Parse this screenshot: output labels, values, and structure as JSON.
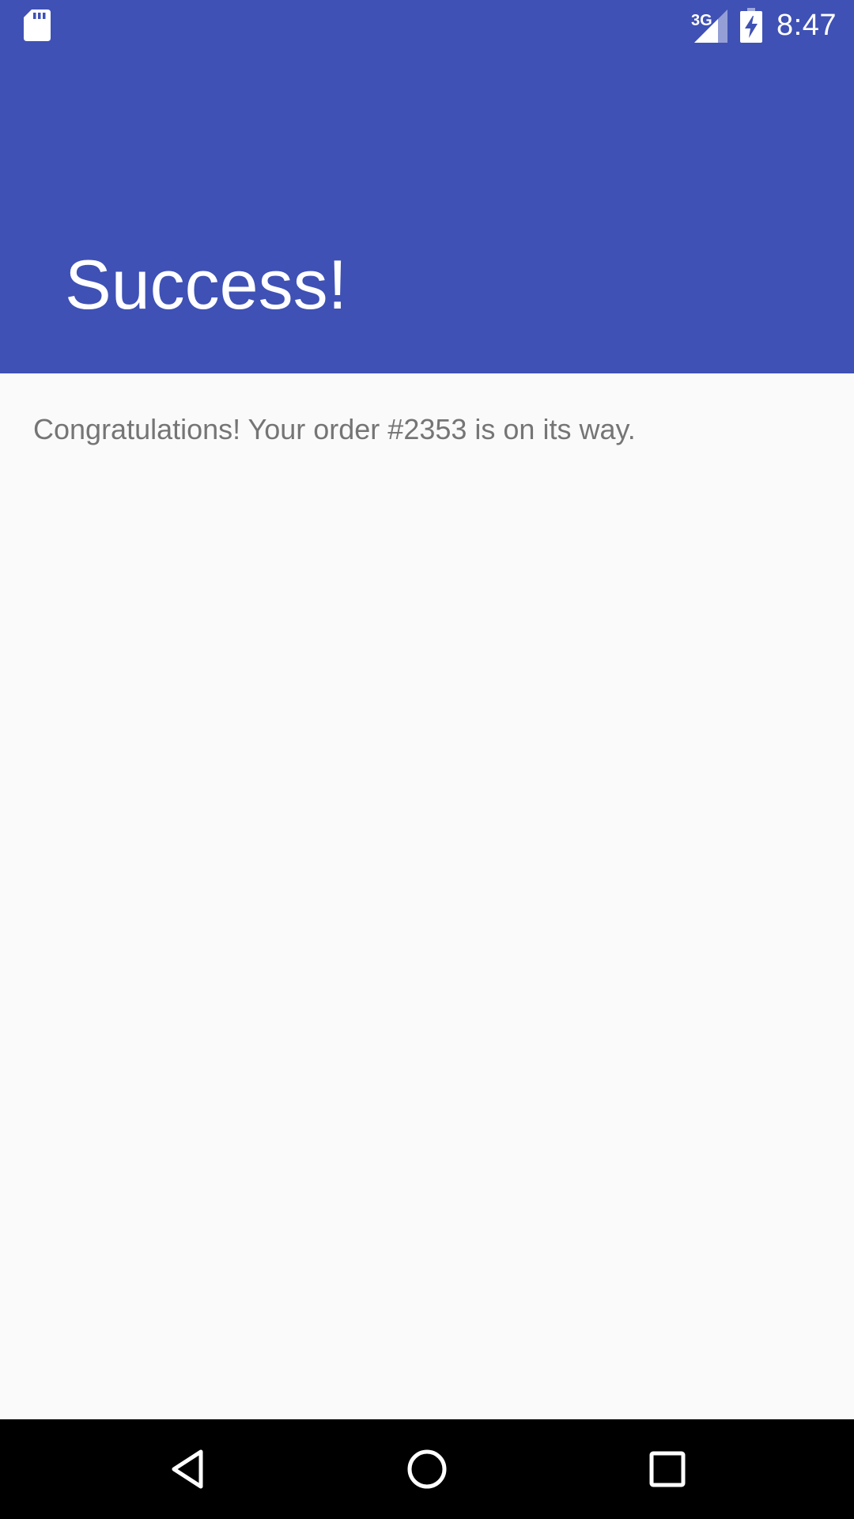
{
  "status_bar": {
    "network_type": "3G",
    "time": "8:47",
    "icons": [
      "sd-card-icon",
      "signal-icon",
      "battery-charging-icon"
    ]
  },
  "header": {
    "title": "Success!"
  },
  "content": {
    "message": "Congratulations! Your order #2353 is on its way."
  },
  "nav_bar": {
    "icons": [
      "back-icon",
      "home-icon",
      "recents-icon"
    ]
  },
  "colors": {
    "primary": "#3F51B5",
    "background": "#FAFAFA",
    "message_text": "#757575",
    "nav_bar": "#000000"
  }
}
